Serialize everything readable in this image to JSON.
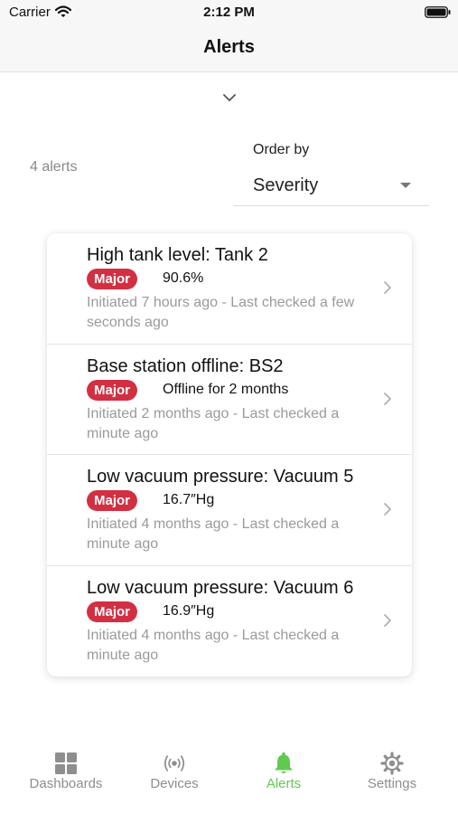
{
  "status_bar": {
    "carrier": "Carrier",
    "time": "2:12 PM"
  },
  "nav": {
    "title": "Alerts"
  },
  "summary": {
    "count_label": "4 alerts",
    "order_by_label": "Order by",
    "order_by_value": "Severity"
  },
  "alerts": [
    {
      "title": "High tank level: Tank 2",
      "severity": "Major",
      "value": "90.6%",
      "meta": "Initiated 7 hours ago - Last checked a few seconds ago"
    },
    {
      "title": "Base station offline: BS2",
      "severity": "Major",
      "value": "Offline for 2 months",
      "meta": "Initiated 2 months ago - Last checked a minute ago"
    },
    {
      "title": "Low vacuum pressure: Vacuum 5",
      "severity": "Major",
      "value": "16.7″Hg",
      "meta": "Initiated 4 months ago - Last checked a minute ago"
    },
    {
      "title": "Low vacuum pressure: Vacuum 6",
      "severity": "Major",
      "value": "16.9″Hg",
      "meta": "Initiated 4 months ago - Last checked a minute ago"
    }
  ],
  "tabs": [
    {
      "label": "Dashboards",
      "icon": "dashboard-grid-icon",
      "active": false
    },
    {
      "label": "Devices",
      "icon": "broadcast-icon",
      "active": false
    },
    {
      "label": "Alerts",
      "icon": "bell-icon",
      "active": true
    },
    {
      "label": "Settings",
      "icon": "gear-icon",
      "active": false
    }
  ],
  "colors": {
    "accent_active": "#5fcb4e",
    "severity_major": "#d32f43",
    "tab_inactive": "#8e8e8e",
    "secondary_text": "#9a9a9a"
  }
}
